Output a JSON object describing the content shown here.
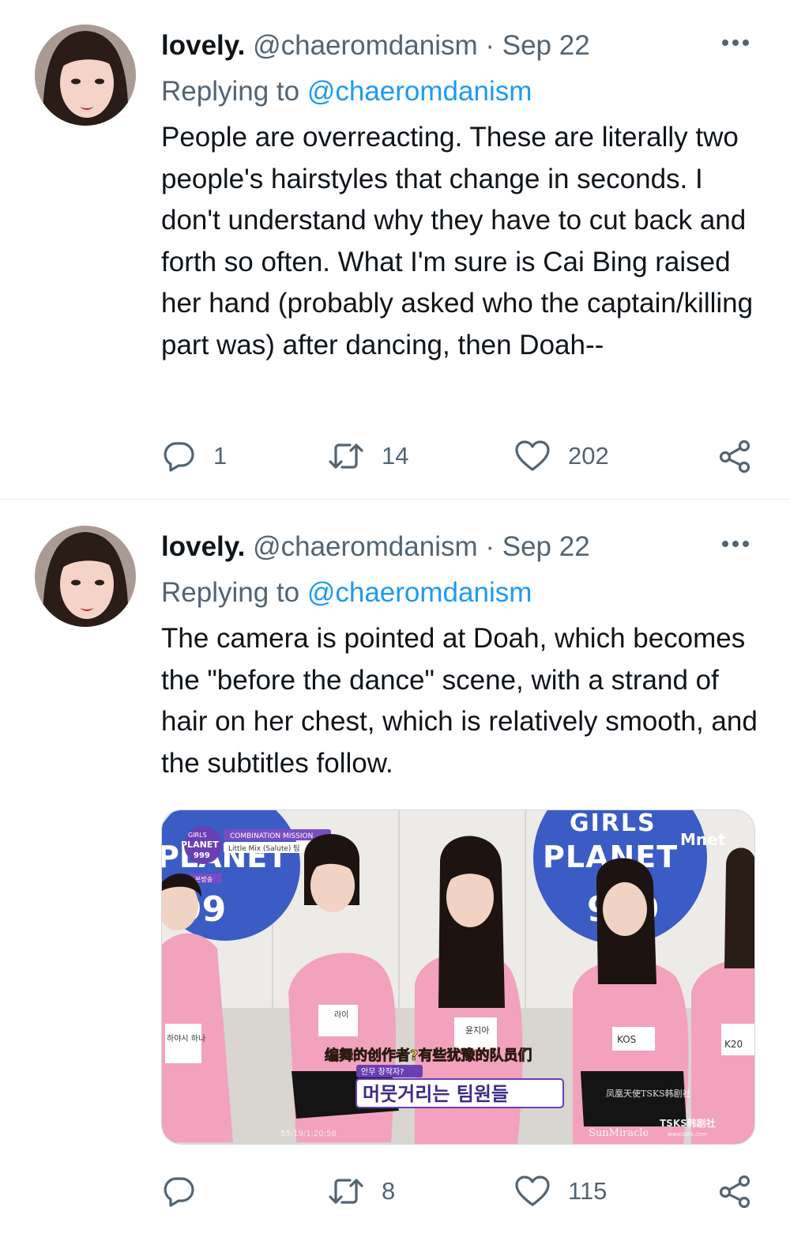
{
  "tweets": [
    {
      "display_name": "lovely.",
      "handle": "@chaeromdanism",
      "separator": "·",
      "date": "Sep 22",
      "replying_prefix": "Replying to",
      "replying_to": "@chaeromdanism",
      "text": "People are overreacting.  These are literally two people's hairstyles that change in seconds.  I don't understand why they have to cut back and forth so often.  What I'm sure is Cai Bing raised her hand (probably asked who the captain/killing part was) after dancing, then Doah--",
      "reply_count": "1",
      "retweet_count": "14",
      "like_count": "202"
    },
    {
      "display_name": "lovely.",
      "handle": "@chaeromdanism",
      "separator": "·",
      "date": "Sep 22",
      "replying_prefix": "Replying to",
      "replying_to": "@chaeromdanism",
      "text": "The camera is pointed at Doah, which becomes the \"before the dance\" scene, with a strand of hair on her chest, which is relatively smooth, and the subtitles follow.",
      "retweet_count": "8",
      "like_count": "115",
      "media": {
        "logo_top": "GIRLS",
        "logo_main": "PLANET",
        "logo_num": "999",
        "badge_top": "GIRLS",
        "badge_main": "PLANET",
        "badge_num": "999",
        "mission_title": "COMBINATION MISSION",
        "mission_team": "Little Mix (Salute) 팀",
        "broadcast_tag": "본방송",
        "channel": "Mnet",
        "wall_number": "99",
        "subtitle_cn": "编舞的创作者?有些犹豫的队员们",
        "subtitle_kr_small": "안무 창작자?",
        "subtitle_kr": "머뭇거리는 팀원들",
        "watermark_cn": "凤凰天使TSKS韩剧社",
        "watermark_en": "SunMiracle",
        "watermark_logo": "TSKS韩剧社",
        "watermark_site": "www.tsks.com",
        "timestamp": "55:19/1:20:58",
        "name_tag_1": "하야시 하나",
        "name_tag_3": "윤지아",
        "name_tag_4": "KOS",
        "name_tag_5": "K20"
      },
      "colors": {
        "shirt": "#f2a2bd",
        "wall": "#e9e6e3",
        "logo_blue": "#3b5cc4"
      }
    }
  ],
  "icons": [
    "reply-icon",
    "retweet-icon",
    "like-icon",
    "share-icon",
    "more-icon"
  ],
  "colors": {
    "text": "#0f1419",
    "secondary": "#536471",
    "link": "#1d9bf0",
    "divider": "#eff3f4"
  }
}
